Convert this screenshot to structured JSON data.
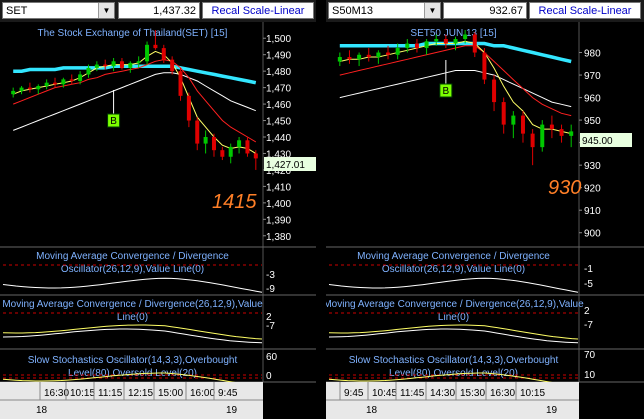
{
  "colors": {
    "background": "#000000",
    "up_candle": "#00c800",
    "down_candle": "#e00000",
    "ma_cyan": "#33e6ff",
    "ma_white": "#ffffff",
    "ma_yellow": "#ffff66",
    "ma_red": "#ff2020",
    "annotation": "#ff7f27",
    "title_text": "#7fb2ff",
    "osc_text": "#7fb2ff",
    "marker_b": "#7cff00"
  },
  "panes": [
    {
      "symbol": "SET",
      "last_price": "1,437.32",
      "recal_label": "Recal Scale-Linear",
      "chart_title": "The Stock Exchange of Thailand(SET) [15]",
      "price_axis": [
        "1,500",
        "1,490",
        "1,480",
        "1,470",
        "1,460",
        "1,450",
        "1,440",
        "1,430",
        "1,420",
        "1,410",
        "1,400",
        "1,390",
        "1,380"
      ],
      "current_price_label": "1,427.01",
      "annotation": "1415",
      "marker": "B",
      "macd1_label": "Moving Average Convergence / Divergence Oscillator(26,12,9),Value Line(0)",
      "macd1_axis": [
        "-3",
        "-9"
      ],
      "macd2_label": "Moving Average Convergence / Divergence(26,12,9),Value Line(0)",
      "macd2_axis": [
        "2",
        "-7"
      ],
      "stoch_label": "Slow Stochastics Oscillator(14,3,3),Overbought Level(80),Oversold Level(20)",
      "stoch_axis": [
        "60",
        "0"
      ],
      "time_labels": [
        "16:30",
        "10:15",
        "11:15",
        "12:15",
        "15:00",
        "16:00",
        "9:45"
      ],
      "date_labels": [
        "18",
        "19"
      ]
    },
    {
      "symbol": "S50M13",
      "last_price": "932.67",
      "recal_label": "Recal Scale-Linear",
      "chart_title": "SET50 JUN 13 [15]",
      "price_axis": [
        "980",
        "970",
        "960",
        "950",
        "940",
        "930",
        "920",
        "910",
        "900"
      ],
      "current_price_label": "945.00",
      "annotation": "930",
      "marker": "B",
      "macd1_label": "Moving Average Convergence / Divergence Oscillator(26,12,9),Value Line(0)",
      "macd1_axis": [
        "-1",
        "-5"
      ],
      "macd2_label": "Moving Average Convergence / Divergence(26,12,9),Value Line(0)",
      "macd2_axis": [
        "2",
        "-7"
      ],
      "stoch_label": "Slow Stochastics Oscillator(14,3,3),Overbought Level(80),Oversold Level(20)",
      "stoch_axis": [
        "70",
        "10"
      ],
      "time_labels": [
        "9:45",
        "10:45",
        "11:45",
        "14:30",
        "15:30",
        "16:30",
        "10:15"
      ],
      "date_labels": [
        "18",
        "19"
      ]
    }
  ],
  "chart_data": [
    {
      "type": "candlestick",
      "title": "The Stock Exchange of Thailand(SET) [15]",
      "ylim": [
        1375,
        1505
      ],
      "candles": [
        [
          1466,
          1470,
          1464,
          1468
        ],
        [
          1468,
          1471,
          1466,
          1470
        ],
        [
          1470,
          1473,
          1467,
          1469
        ],
        [
          1469,
          1472,
          1466,
          1471
        ],
        [
          1471,
          1475,
          1469,
          1473
        ],
        [
          1473,
          1476,
          1470,
          1472
        ],
        [
          1472,
          1476,
          1470,
          1475
        ],
        [
          1475,
          1478,
          1472,
          1474
        ],
        [
          1474,
          1480,
          1472,
          1478
        ],
        [
          1478,
          1484,
          1476,
          1482
        ],
        [
          1482,
          1486,
          1480,
          1484
        ],
        [
          1484,
          1487,
          1481,
          1483
        ],
        [
          1483,
          1488,
          1480,
          1486
        ],
        [
          1486,
          1488,
          1481,
          1482
        ],
        [
          1482,
          1486,
          1479,
          1485
        ],
        [
          1485,
          1489,
          1482,
          1486
        ],
        [
          1486,
          1498,
          1484,
          1496
        ],
        [
          1496,
          1505,
          1493,
          1494
        ],
        [
          1494,
          1496,
          1485,
          1487
        ],
        [
          1487,
          1489,
          1478,
          1480
        ],
        [
          1480,
          1482,
          1462,
          1465
        ],
        [
          1465,
          1467,
          1446,
          1450
        ],
        [
          1450,
          1452,
          1432,
          1436
        ],
        [
          1436,
          1444,
          1430,
          1440
        ],
        [
          1440,
          1442,
          1428,
          1432
        ],
        [
          1432,
          1434,
          1426,
          1428
        ],
        [
          1428,
          1436,
          1424,
          1434
        ],
        [
          1434,
          1440,
          1430,
          1438
        ],
        [
          1438,
          1440,
          1428,
          1430
        ],
        [
          1430,
          1432,
          1420,
          1427
        ]
      ],
      "ma_cyan": [
        1480,
        1480,
        1481,
        1481,
        1481,
        1481,
        1482,
        1482,
        1482,
        1482,
        1482,
        1482,
        1483,
        1483,
        1483,
        1483,
        1483,
        1483,
        1483,
        1483,
        1482,
        1481,
        1480,
        1479,
        1478,
        1477,
        1476,
        1475,
        1474,
        1473
      ],
      "ma_white": [
        1444,
        1446,
        1448,
        1450,
        1452,
        1454,
        1456,
        1458,
        1460,
        1462,
        1464,
        1466,
        1468,
        1470,
        1472,
        1474,
        1476,
        1478,
        1479,
        1479,
        1478,
        1476,
        1474,
        1471,
        1468,
        1465,
        1462,
        1460,
        1458,
        1456
      ],
      "ma_red": [
        1460,
        1462,
        1464,
        1466,
        1468,
        1470,
        1471,
        1472,
        1473,
        1475,
        1476,
        1478,
        1479,
        1480,
        1481,
        1482,
        1484,
        1486,
        1487,
        1486,
        1482,
        1476,
        1468,
        1462,
        1456,
        1450,
        1446,
        1443,
        1440,
        1437
      ],
      "ma_yellow": [
        1466,
        1468,
        1469,
        1470,
        1471,
        1472,
        1473,
        1474,
        1476,
        1479,
        1482,
        1483,
        1484,
        1484,
        1484,
        1485,
        1489,
        1492,
        1490,
        1485,
        1476,
        1464,
        1452,
        1446,
        1440,
        1435,
        1433,
        1434,
        1433,
        1430
      ]
    },
    {
      "type": "candlestick",
      "title": "SET50 JUN 13 [15]",
      "ylim": [
        895,
        990
      ],
      "candles": [
        [
          976,
          980,
          974,
          978
        ],
        [
          978,
          981,
          975,
          977
        ],
        [
          977,
          980,
          974,
          979
        ],
        [
          979,
          982,
          976,
          978
        ],
        [
          978,
          981,
          975,
          980
        ],
        [
          980,
          983,
          977,
          979
        ],
        [
          979,
          984,
          977,
          982
        ],
        [
          982,
          986,
          980,
          984
        ],
        [
          984,
          986,
          980,
          982
        ],
        [
          982,
          986,
          979,
          985
        ],
        [
          985,
          988,
          983,
          986
        ],
        [
          986,
          988,
          982,
          984
        ],
        [
          984,
          987,
          981,
          986
        ],
        [
          986,
          990,
          984,
          988
        ],
        [
          988,
          989,
          978,
          980
        ],
        [
          980,
          982,
          966,
          968
        ],
        [
          968,
          970,
          954,
          958
        ],
        [
          958,
          960,
          944,
          948
        ],
        [
          948,
          954,
          942,
          952
        ],
        [
          952,
          954,
          940,
          944
        ],
        [
          944,
          946,
          930,
          938
        ],
        [
          938,
          950,
          936,
          948
        ],
        [
          948,
          952,
          942,
          946
        ],
        [
          946,
          948,
          940,
          943
        ],
        [
          943,
          948,
          938,
          945
        ]
      ],
      "ma_cyan": [
        983,
        983,
        983,
        983,
        983,
        983,
        983,
        983,
        983,
        984,
        984,
        984,
        984,
        984,
        984,
        984,
        983,
        983,
        982,
        981,
        980,
        979,
        978,
        977,
        976
      ],
      "ma_white": [
        960,
        961,
        962,
        963,
        964,
        965,
        966,
        967,
        968,
        969,
        970,
        971,
        972,
        972,
        972,
        971,
        970,
        968,
        966,
        964,
        962,
        960,
        958,
        957,
        956
      ],
      "ma_red": [
        970,
        971,
        972,
        973,
        974,
        975,
        976,
        977,
        978,
        979,
        980,
        981,
        982,
        983,
        983,
        980,
        976,
        972,
        968,
        964,
        960,
        957,
        955,
        953,
        952
      ],
      "ma_yellow": [
        976,
        977,
        977,
        978,
        978,
        979,
        980,
        981,
        982,
        983,
        984,
        984,
        984,
        985,
        984,
        980,
        973,
        965,
        958,
        954,
        948,
        946,
        946,
        945,
        944
      ]
    }
  ]
}
